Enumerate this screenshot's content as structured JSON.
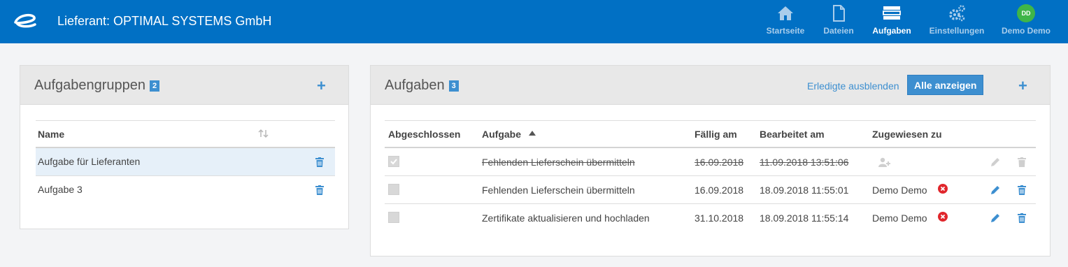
{
  "header": {
    "title": "Lieferant: OPTIMAL SYSTEMS GmbH",
    "nav": [
      {
        "label": "Startseite",
        "icon": "home-icon"
      },
      {
        "label": "Dateien",
        "icon": "file-icon"
      },
      {
        "label": "Aufgaben",
        "icon": "tasks-icon",
        "active": true
      },
      {
        "label": "Einstellungen",
        "icon": "gears-icon"
      },
      {
        "label": "Demo Demo",
        "icon": "avatar",
        "initials": "DD"
      }
    ]
  },
  "groups": {
    "title": "Aufgabengruppen",
    "count": "2",
    "add": "+",
    "column_name": "Name",
    "items": [
      {
        "name": "Aufgabe für Lieferanten",
        "selected": true
      },
      {
        "name": "Aufgabe 3",
        "selected": false
      }
    ]
  },
  "tasks": {
    "title": "Aufgaben",
    "count": "3",
    "hide_done": "Erledigte ausblenden",
    "show_all": "Alle anzeigen",
    "add": "+",
    "columns": {
      "done": "Abgeschlossen",
      "task": "Aufgabe",
      "due": "Fällig am",
      "edited": "Bearbeitet am",
      "assigned": "Zugewiesen zu"
    },
    "rows": [
      {
        "done": true,
        "task": "Fehlenden Lieferschein übermitteln",
        "due": "16.09.2018",
        "edited": "11.09.2018 13:51:06",
        "assigned": ""
      },
      {
        "done": false,
        "task": "Fehlenden Lieferschein übermitteln",
        "due": "16.09.2018",
        "edited": "18.09.2018 11:55:01",
        "assigned": "Demo Demo"
      },
      {
        "done": false,
        "task": "Zertifikate aktualisieren und hochladen",
        "due": "31.10.2018",
        "edited": "18.09.2018 11:55:14",
        "assigned": "Demo Demo"
      }
    ]
  },
  "colors": {
    "header_bg": "#0170c4",
    "accent": "#3d8fd0",
    "avatar_green": "#3fb548",
    "remove_red": "#e0262c"
  }
}
